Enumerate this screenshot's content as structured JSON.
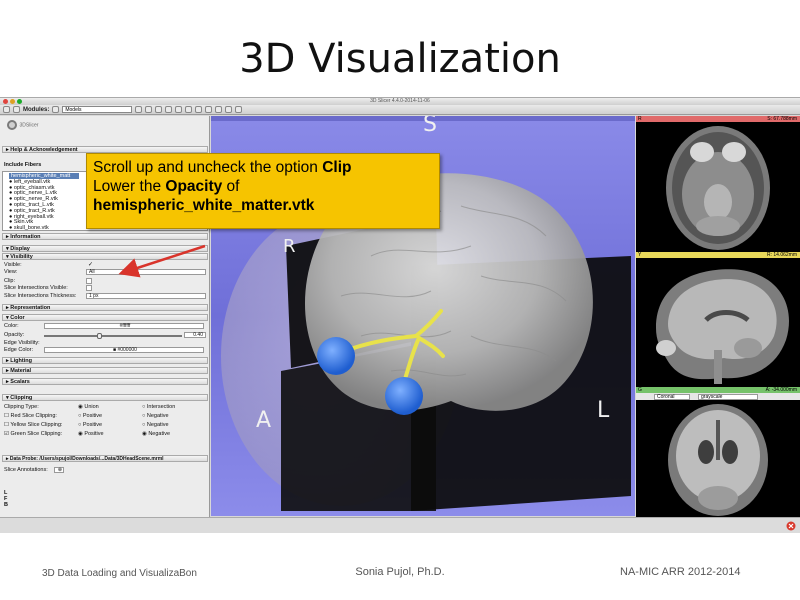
{
  "slide": {
    "title": "3D Visualization",
    "footer_left": "3D Data Loading and VisualizaBon",
    "footer_center": "Sonia Pujol, Ph.D.",
    "footer_right": "NA-MIC ARR 2012-2014"
  },
  "window": {
    "title": "3D Slicer 4.4.0-2014-11-06"
  },
  "toolbar": {
    "modules_label": "Modules:",
    "module_selected": "Models"
  },
  "left_panel": {
    "logo_text": "3DSlicer",
    "sections": {
      "help": "Help & Acknowledgement",
      "information": "Information",
      "display": "Display",
      "visibility": "Visibility",
      "representation": "Representation",
      "color": "Color",
      "lighting": "Lighting",
      "material": "Material",
      "scalars": "Scalars",
      "clipping": "Clipping",
      "data_probe": "Data Probe: /Users/spujol/Downloads/...Data/3DHeadScene.mrml"
    },
    "include_fibers_label": "Include Fibers",
    "fibers": [
      "hemispheric_white_matt",
      "left_eyeball.vtk",
      "optic_chiasm.vtk",
      "optic_nerve_L.vtk",
      "optic_nerve_R.vtk",
      "optic_tract_L.vtk",
      "optic_tract_R.vtk",
      "right_eyeball.vtk",
      "Skin.vtk",
      "skull_bone.vtk"
    ],
    "visibility": {
      "visible_label": "Visible:",
      "view_label": "View:",
      "view_value": "All",
      "clip_label": "Clip:",
      "slice_intersections_visible_label": "Slice Intersections Visible:",
      "slice_intersections_thickness_label": "Slice Intersections Thickness:",
      "thickness_value": "1 px"
    },
    "color": {
      "color_label": "Color:",
      "color_value": "#ffffff",
      "opacity_label": "Opacity:",
      "opacity_value": "0.40",
      "opacity_fraction": 0.4,
      "edge_visibility_label": "Edge Visibility:",
      "edge_color_label": "Edge Color:",
      "edge_color_value": "#000000"
    },
    "clipping": {
      "clipping_type_label": "Clipping Type:",
      "union_label": "Union",
      "intersection_label": "Intersection",
      "red_label": "Red Slice Clipping:",
      "yellow_label": "Yellow Slice Clipping:",
      "green_label": "Green Slice Clipping:",
      "positive_label": "Positive",
      "negative_label": "Negative"
    },
    "slice_annotations_label": "Slice Annotations:",
    "lfb": [
      "L",
      "F",
      "B"
    ]
  },
  "view3d": {
    "labels": {
      "s": "S",
      "r": "R",
      "a": "A",
      "l": "L"
    }
  },
  "slices": {
    "red": {
      "letter": "R",
      "value": "S: 67.788mm",
      "bar_color": "#e06a6a"
    },
    "yellow": {
      "letter": "Y",
      "value": "R: 14.062mm",
      "bar_color": "#e8d85a"
    },
    "green": {
      "letter": "G",
      "value": "A: -34.000mm",
      "bar_color": "#76c26a",
      "orientation": "Coronal",
      "colormap": "grayscale"
    }
  },
  "callout": {
    "line1_prefix": "Scroll up and uncheck the option ",
    "line1_bold": "Clip",
    "line2_prefix": "Lower the ",
    "line2_bold": "Opacity",
    "line2_suffix": " of",
    "line3_bold": "hemispheric_white_matter.vtk"
  },
  "colors": {
    "callout_bg": "#f6c400",
    "arrow": "#d9342b",
    "view_bg": "#7b7be2"
  }
}
